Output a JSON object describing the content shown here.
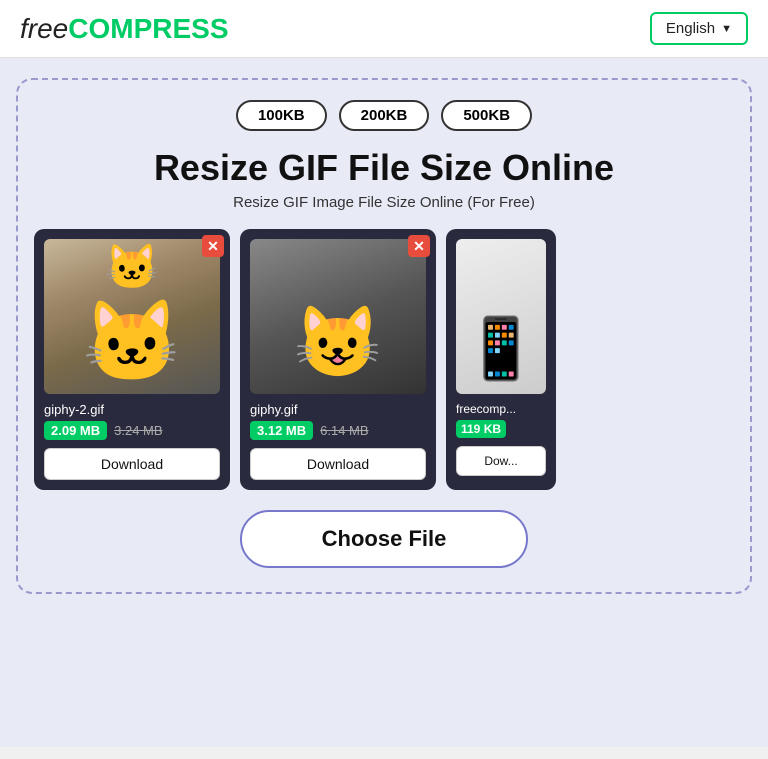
{
  "header": {
    "logo_free": "free",
    "logo_compress": "COMPRESS",
    "lang_label": "English",
    "lang_chevron": "▼"
  },
  "size_buttons": [
    "100KB",
    "200KB",
    "500KB"
  ],
  "main_title": "Resize GIF File Size Online",
  "main_subtitle": "Resize GIF Image File Size Online (For Free)",
  "cards": [
    {
      "filename": "giphy-2.gif",
      "size_new": "2.09 MB",
      "size_old": "3.24 MB",
      "download_label": "Download"
    },
    {
      "filename": "giphy.gif",
      "size_new": "3.12 MB",
      "size_old": "6.14 MB",
      "download_label": "Download"
    },
    {
      "filename": "freecomp...",
      "size_new": "119 KB",
      "size_old": "",
      "download_label": "Dow..."
    }
  ],
  "choose_file_label": "Choose File"
}
